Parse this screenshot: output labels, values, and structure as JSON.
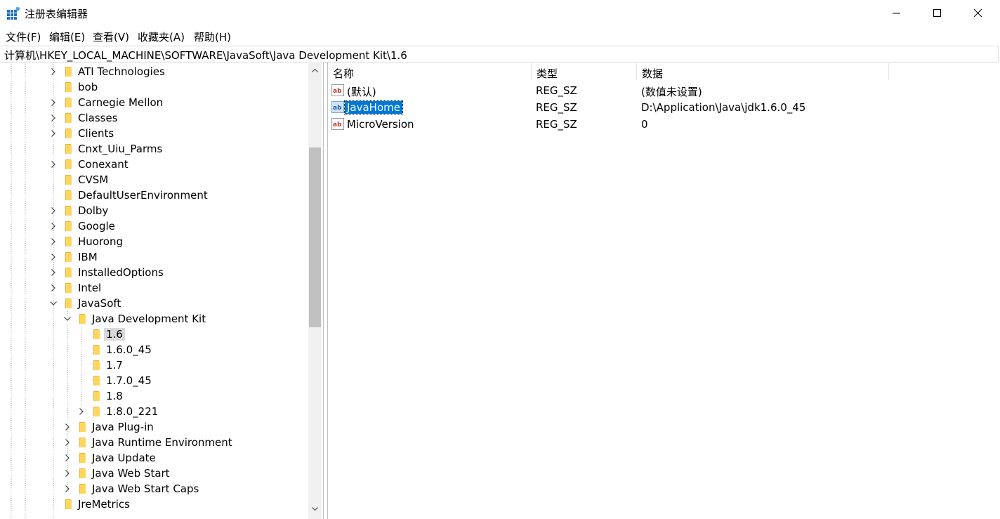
{
  "window": {
    "title": "注册表编辑器",
    "minimize_icon": "minimize-icon",
    "maximize_icon": "maximize-icon",
    "close_icon": "close-icon"
  },
  "menu": [
    "文件(F)",
    "编辑(E)",
    "查看(V)",
    "收藏夹(A)",
    "帮助(H)"
  ],
  "address": "计算机\\HKEY_LOCAL_MACHINE\\SOFTWARE\\JavaSoft\\Java Development Kit\\1.6",
  "tree": [
    {
      "label": "ATI Technologies",
      "depth": 0,
      "state": "collapsed"
    },
    {
      "label": "bob",
      "depth": 0,
      "state": "leaf"
    },
    {
      "label": "Carnegie Mellon",
      "depth": 0,
      "state": "collapsed"
    },
    {
      "label": "Classes",
      "depth": 0,
      "state": "collapsed"
    },
    {
      "label": "Clients",
      "depth": 0,
      "state": "collapsed"
    },
    {
      "label": "Cnxt_Uiu_Parms",
      "depth": 0,
      "state": "leaf"
    },
    {
      "label": "Conexant",
      "depth": 0,
      "state": "collapsed"
    },
    {
      "label": "CVSM",
      "depth": 0,
      "state": "leaf"
    },
    {
      "label": "DefaultUserEnvironment",
      "depth": 0,
      "state": "leaf"
    },
    {
      "label": "Dolby",
      "depth": 0,
      "state": "collapsed"
    },
    {
      "label": "Google",
      "depth": 0,
      "state": "collapsed"
    },
    {
      "label": "Huorong",
      "depth": 0,
      "state": "collapsed"
    },
    {
      "label": "IBM",
      "depth": 0,
      "state": "collapsed"
    },
    {
      "label": "InstalledOptions",
      "depth": 0,
      "state": "collapsed"
    },
    {
      "label": "Intel",
      "depth": 0,
      "state": "collapsed"
    },
    {
      "label": "JavaSoft",
      "depth": 0,
      "state": "expanded"
    },
    {
      "label": "Java Development Kit",
      "depth": 1,
      "state": "expanded"
    },
    {
      "label": "1.6",
      "depth": 2,
      "state": "leaf",
      "selected": true
    },
    {
      "label": "1.6.0_45",
      "depth": 2,
      "state": "leaf"
    },
    {
      "label": "1.7",
      "depth": 2,
      "state": "leaf"
    },
    {
      "label": "1.7.0_45",
      "depth": 2,
      "state": "leaf"
    },
    {
      "label": "1.8",
      "depth": 2,
      "state": "leaf"
    },
    {
      "label": "1.8.0_221",
      "depth": 2,
      "state": "collapsed"
    },
    {
      "label": "Java Plug-in",
      "depth": 1,
      "state": "collapsed"
    },
    {
      "label": "Java Runtime Environment",
      "depth": 1,
      "state": "collapsed"
    },
    {
      "label": "Java Update",
      "depth": 1,
      "state": "collapsed"
    },
    {
      "label": "Java Web Start",
      "depth": 1,
      "state": "collapsed"
    },
    {
      "label": "Java Web Start Caps",
      "depth": 1,
      "state": "collapsed"
    },
    {
      "label": "JreMetrics",
      "depth": 0,
      "state": "leaf"
    }
  ],
  "columns": {
    "name": "名称",
    "type": "类型",
    "data": "数据"
  },
  "values": [
    {
      "name": "(默认)",
      "type": "REG_SZ",
      "data": "(数值未设置)",
      "icon": "string-value-icon"
    },
    {
      "name": "JavaHome",
      "type": "REG_SZ",
      "data": "D:\\Application\\Java\\jdk1.6.0_45",
      "icon": "string-value-icon",
      "selected": true
    },
    {
      "name": "MicroVersion",
      "type": "REG_SZ",
      "data": "0",
      "icon": "string-value-icon"
    }
  ],
  "colors": {
    "selection": "#0078d7",
    "tree_selection": "#d9d9d9",
    "folder": "#ffd65c",
    "scroll_thumb": "#c1c1c1"
  }
}
